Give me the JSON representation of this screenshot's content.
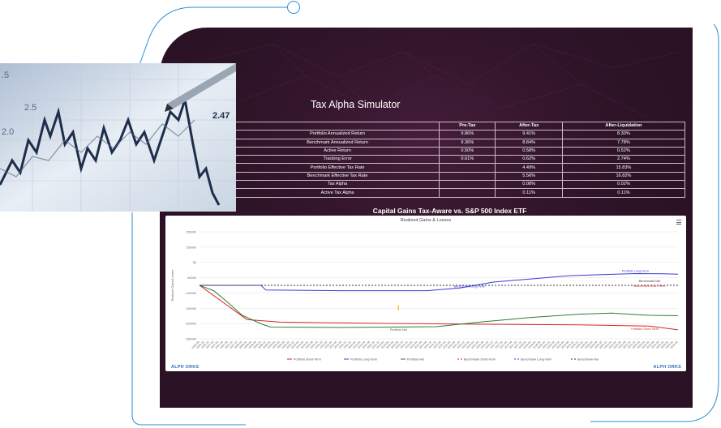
{
  "simulator": {
    "title": "Tax Alpha Simulator",
    "columns": [
      "",
      "Pre-Tax",
      "After-Tax",
      "After-Liquidation"
    ],
    "rows": [
      {
        "label": "Portfolio Annualized Return",
        "pre": "9.86%",
        "after": "9.41%",
        "liq": "8.30%"
      },
      {
        "label": "Benchmark Annualized Return",
        "pre": "9.36%",
        "after": "8.84%",
        "liq": "7.78%"
      },
      {
        "label": "Active Return",
        "pre": "0.50%",
        "after": "0.58%",
        "liq": "0.52%"
      },
      {
        "label": "Tracking Error",
        "pre": "0.61%",
        "after": "0.62%",
        "liq": "2.74%"
      },
      {
        "label": "Portfolio Effective Tax Rate",
        "pre": "",
        "after": "4.49%",
        "liq": "15.83%"
      },
      {
        "label": "Benchmark Effective Tax Rate",
        "pre": "",
        "after": "5.56%",
        "liq": "16.82%"
      },
      {
        "label": "Tax Alpha",
        "pre": "",
        "after": "0.08%",
        "liq": "0.02%"
      },
      {
        "label": "Active Tax Alpha",
        "pre": "",
        "after": "0.11%",
        "liq": "0.11%"
      }
    ]
  },
  "chart_title": "Capital Gains Tax-Aware vs. S&P 500 Index ETF",
  "chart_data": {
    "type": "line",
    "title": "Realized Gains & Losses",
    "ylabel": "Realized Gains/Losses",
    "ylim": [
      -250000,
      250000
    ],
    "y_ticks": [
      "250000",
      "150000",
      "50",
      "-50000",
      "-100000",
      "-150000",
      "-200000",
      "-250000"
    ],
    "x": [
      "2006-08",
      "2006-10",
      "2006-12",
      "2007-02",
      "2007-04",
      "2007-06",
      "2007-08",
      "2007-10",
      "2007-12",
      "2008-02",
      "2008-04",
      "2008-06",
      "2008-08",
      "2008-10",
      "2008-12",
      "2009-02",
      "2009-04",
      "2009-06",
      "2009-08",
      "2009-10",
      "2009-12",
      "2010-02",
      "2010-04",
      "2010-06",
      "2010-08",
      "2010-10",
      "2010-12",
      "2011-02",
      "2011-04",
      "2011-06",
      "2011-08",
      "2011-10",
      "2011-12",
      "2012-02",
      "2012-04",
      "2012-06",
      "2012-08",
      "2012-10",
      "2012-12",
      "2013-02",
      "2013-04",
      "2013-06",
      "2013-08",
      "2013-10",
      "2013-12",
      "2014-02",
      "2014-04",
      "2014-06",
      "2014-08",
      "2014-10",
      "2014-12",
      "2015-02",
      "2015-04",
      "2015-06",
      "2015-08",
      "2015-10",
      "2015-12",
      "2016-02",
      "2016-04",
      "2016-06",
      "2016-08",
      "2016-10",
      "2016-12",
      "2017-02",
      "2017-04",
      "2017-06",
      "2017-08",
      "2017-10",
      "2017-12",
      "2018-02",
      "2018-04",
      "2018-06",
      "2018-08",
      "2018-10",
      "2018-12",
      "2019-02",
      "2019-04",
      "2019-06",
      "2019-08",
      "2019-10",
      "2019-12",
      "2020-02",
      "2020-04",
      "2020-06",
      "2020-08",
      "2020-10",
      "2020-12",
      "2021-02",
      "2021-04",
      "2021-06",
      "2021-08",
      "2021-10",
      "2021-12",
      "2022-02",
      "2022-04",
      "2022-06",
      "2022-08",
      "2022-10",
      "2022-12",
      "2023-02",
      "2023-04",
      "2023-06"
    ],
    "series": [
      {
        "name": "Portfolio Short-Term",
        "color": "#d62728",
        "dash": "",
        "points": [
          [
            0,
            0
          ],
          [
            10,
            -160000
          ],
          [
            17,
            -172000
          ],
          [
            40,
            -178000
          ],
          [
            60,
            -182000
          ],
          [
            80,
            -185000
          ],
          [
            95,
            -190000
          ],
          [
            101,
            -208000
          ]
        ]
      },
      {
        "name": "Portfolio Long-Term",
        "color": "#3a3ad6",
        "dash": "",
        "points": [
          [
            0,
            0
          ],
          [
            13,
            0
          ],
          [
            14,
            -22000
          ],
          [
            30,
            -25000
          ],
          [
            48,
            -25000
          ],
          [
            55,
            -12000
          ],
          [
            62,
            15000
          ],
          [
            70,
            30000
          ],
          [
            78,
            45000
          ],
          [
            85,
            50000
          ],
          [
            92,
            55000
          ],
          [
            98,
            54000
          ],
          [
            101,
            52000
          ]
        ]
      },
      {
        "name": "Portfolio Net",
        "color": "#2e7d32",
        "dash": "",
        "points": [
          [
            0,
            0
          ],
          [
            3,
            -25000
          ],
          [
            6,
            -80000
          ],
          [
            9,
            -140000
          ],
          [
            13,
            -180000
          ],
          [
            15,
            -195000
          ],
          [
            30,
            -197000
          ],
          [
            50,
            -193000
          ],
          [
            60,
            -170000
          ],
          [
            70,
            -150000
          ],
          [
            80,
            -135000
          ],
          [
            87,
            -130000
          ],
          [
            95,
            -140000
          ],
          [
            101,
            -142000
          ]
        ]
      },
      {
        "name": "Benchmark Short-Term",
        "color": "#d62728",
        "dash": "2,2",
        "points": [
          [
            0,
            0
          ],
          [
            101,
            0
          ]
        ]
      },
      {
        "name": "Benchmark Long-Term",
        "color": "#3a3ad6",
        "dash": "2,2",
        "points": [
          [
            0,
            0
          ],
          [
            101,
            0
          ]
        ]
      },
      {
        "name": "Benchmark Net",
        "color": "#333333",
        "dash": "2,2",
        "points": [
          [
            0,
            0
          ],
          [
            101,
            0
          ]
        ]
      }
    ],
    "annotations": [
      {
        "text": "Portfolio Long-Term",
        "x": 92,
        "y": 62000,
        "color": "#3a3ad6"
      },
      {
        "text": "Benchmark Net",
        "x": 95,
        "y": 15000,
        "color": "#333333"
      },
      {
        "text": "Benchmark Short-Term",
        "x": 95,
        "y": -8000,
        "color": "#d62728"
      },
      {
        "text": "Benchmark Long-Term",
        "x": 57,
        "y": -10000,
        "color": "#3a3ad6"
      },
      {
        "text": "Portfolio Net",
        "x": 42,
        "y": -213000,
        "color": "#2e7d32"
      },
      {
        "text": "Portfolio Short-Term",
        "x": 94,
        "y": -208000,
        "color": "#d62728"
      }
    ],
    "grid": true,
    "legend": "bottom"
  },
  "brand": {
    "left": "ALPH  ORKS",
    "right": "ALPH  ORKS"
  }
}
